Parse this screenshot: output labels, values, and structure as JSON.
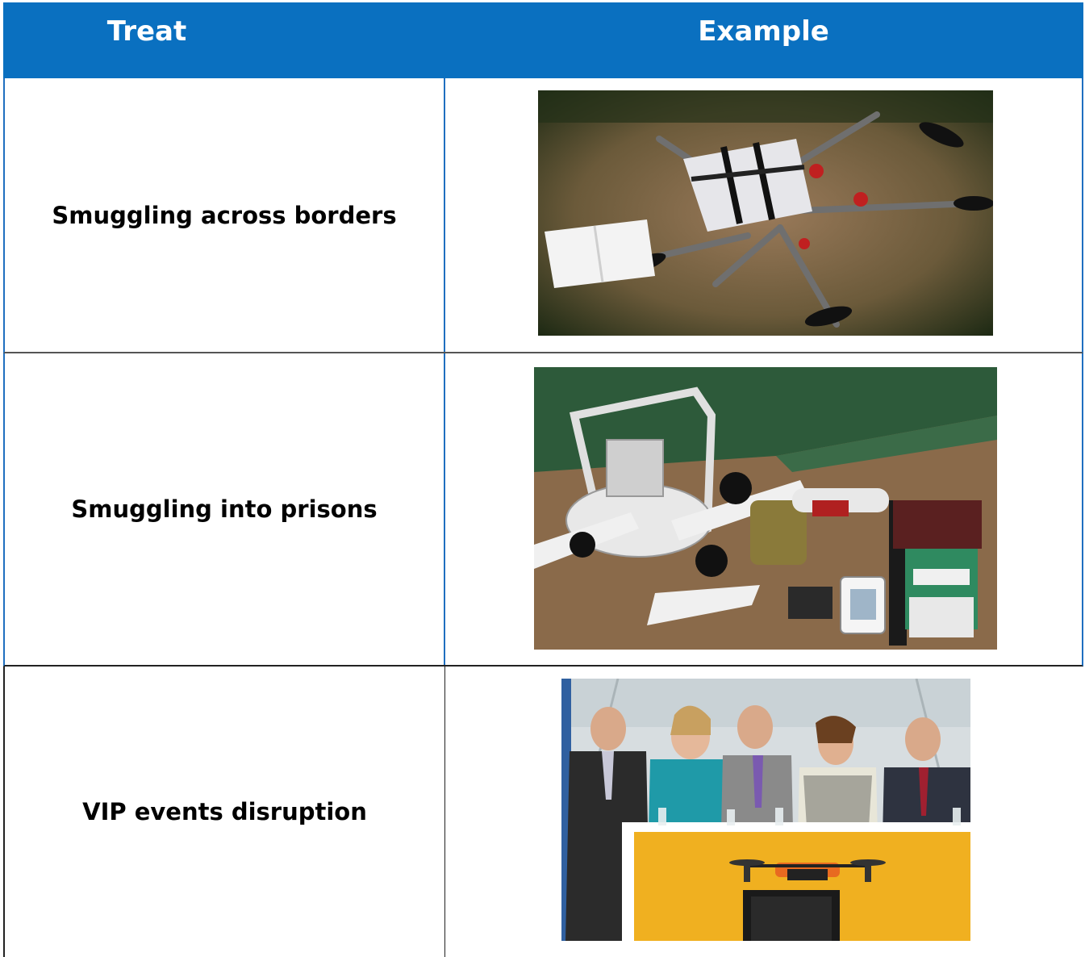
{
  "table": {
    "header": {
      "treat": "Treat",
      "example": "Example"
    },
    "rows": [
      {
        "treat": "Smuggling across borders",
        "photo": "crashed drone with wrapped package on grass"
      },
      {
        "treat": "Smuggling into prisons",
        "photo": "drone with phones, cigarettes and contraband on floor"
      },
      {
        "treat": "VIP events disruption",
        "photo": "drone hovering in front of speakers at podium"
      }
    ]
  },
  "colors": {
    "header_bg": "#0a70c0",
    "border_blue": "#1f6fc0",
    "header_text": "#ffffff"
  }
}
